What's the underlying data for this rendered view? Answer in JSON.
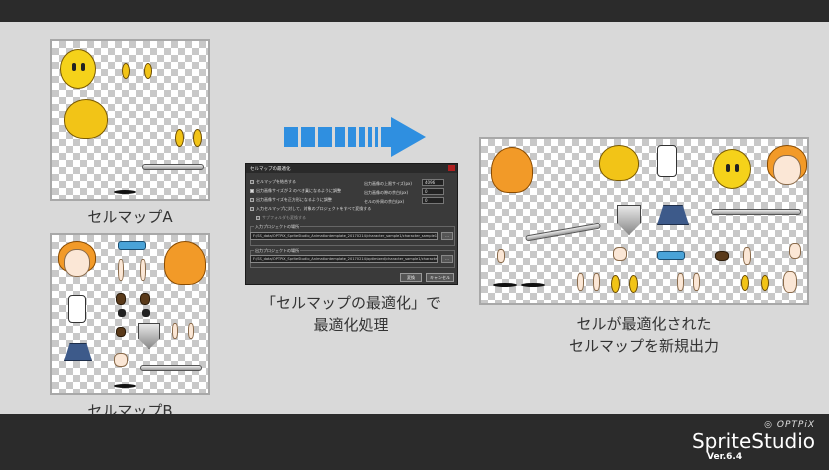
{
  "captions": {
    "cellmap_a": "セルマップA",
    "cellmap_b": "セルマップB",
    "process_line1": "「セルマップの最適化」で",
    "process_line2": "最適化処理",
    "result_line1": "セルが最適化された",
    "result_line2": "セルマップを新規出力"
  },
  "dialog": {
    "title": "セルマップの最適化",
    "options": [
      "セルマップを結合する",
      "出力画像サイズが 2 のべき乗になるように調整",
      "出力画像サイズを正方形になるように調整",
      "入力セルマップに対して、対象のプロジェクトをすべて変換する",
      "サブフォルダも変換する"
    ],
    "right_labels": [
      "出力画像の上限サイズ(px)",
      "出力画像の隙の余白(px)",
      "セルの外周の余白(px)"
    ],
    "right_values": [
      "4096",
      "0",
      "0"
    ],
    "input_group_label": "入力プロジェクトの場所",
    "input_path": "F:/SS_data/OPTPiX_SpriteStudio_Animationtemplate_20170214/character_sample1/character_sample1.ss",
    "output_group_label": "出力プロジェクトの場所",
    "output_path": "F:/SS_data/OPTPiX_SpriteStudio_Animationtemplate_20170214/optimized/character_sample1/character_",
    "browse_label": "...",
    "convert_label": "変換",
    "cancel_label": "キャンセル"
  },
  "logo": {
    "brand": "OPTPiX",
    "name": "SpriteStudio",
    "version": "Ver.6.4"
  },
  "colors": {
    "stage_bg": "#d9d9d9",
    "bar_bg": "#2b2b2b",
    "arrow_blue": "#2f8fe0"
  }
}
